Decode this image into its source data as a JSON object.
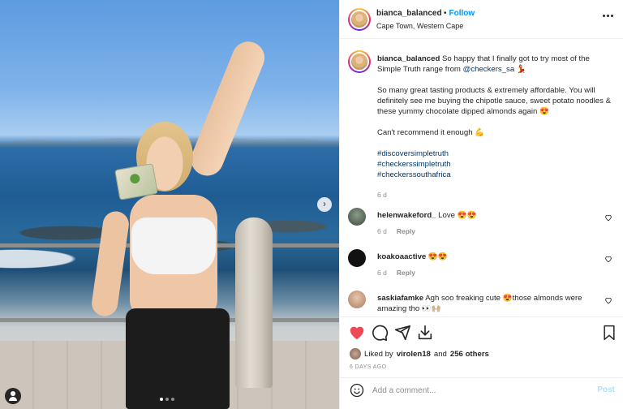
{
  "post": {
    "username": "bianca_balanced",
    "separator": "•",
    "follow_label": "Follow",
    "location": "Cape Town, Western Cape"
  },
  "caption": {
    "username": "bianca_balanced",
    "line1": " So happy that I finally got to try most of the Simple Truth range from ",
    "mention": "@checkers_sa",
    "line1_end": " 💃",
    "para2": "So many great tasting products & extremely affordable. You will definitely see me buying the chipotle sauce, sweet potato noodles & these yummy chocolate dipped almonds again 😍",
    "para3": "Can't recommend it enough 💪",
    "hashtags": [
      "#discoversimpletruth",
      "#checkerssimpletruth",
      "#checkerssouthafrica"
    ],
    "time": "6 d"
  },
  "comments": [
    {
      "username": "helenwakeford_",
      "text": " Love 😍😍",
      "time": "6 d",
      "reply": "Reply",
      "avatar_color": "#4a5b4a"
    },
    {
      "username": "koakoaactive",
      "text": " 😍😍",
      "time": "6 d",
      "reply": "Reply",
      "avatar_color": "#111111"
    },
    {
      "username": "saskiafamke",
      "text": " Agh soo freaking cute 😍those almonds were amazing tho 👀🙌🏼",
      "avatar_color": "#c9a48a"
    }
  ],
  "engagement": {
    "liked_by": "Liked by",
    "liker": "virolen18",
    "and": "and",
    "others": "256 others",
    "date": "6 DAYS AGO"
  },
  "composer": {
    "placeholder": "Add a comment...",
    "post_label": "Post"
  },
  "colors": {
    "link": "#00376b",
    "follow": "#0095f6",
    "like_red": "#ed4956",
    "muted": "#8e8e8e"
  },
  "icons": [
    "more-icon",
    "heart-icon",
    "comment-icon",
    "share-icon",
    "save-icon",
    "bookmark-icon",
    "smile-icon",
    "next-icon",
    "tag-user-icon"
  ]
}
